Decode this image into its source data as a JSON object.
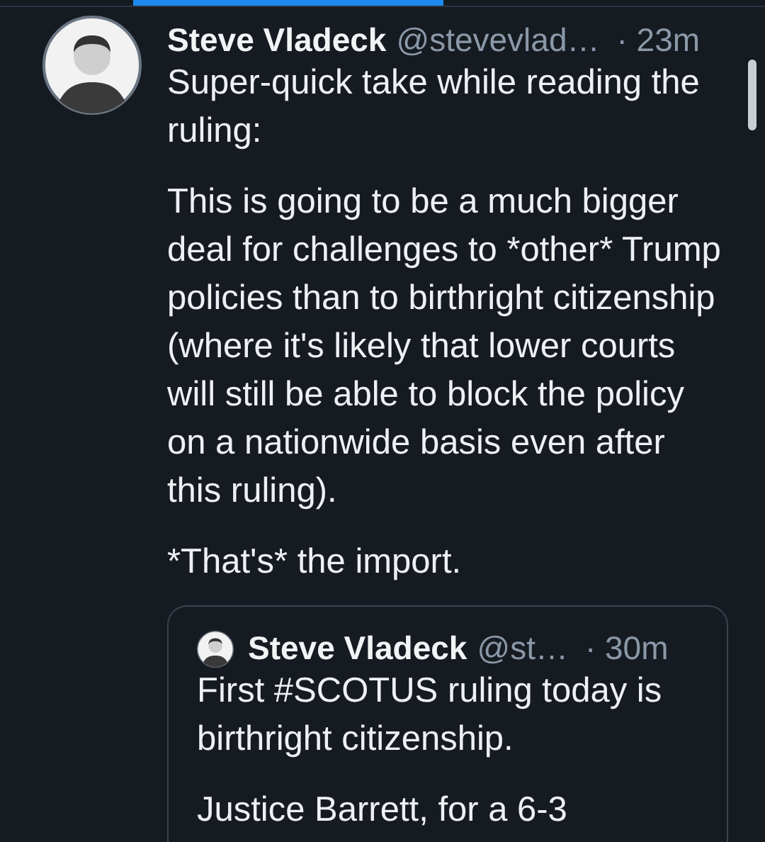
{
  "tabs": [
    {
      "selected": true
    }
  ],
  "post": {
    "author": "Steve Vladeck",
    "handle": "@stevevlad…",
    "time": "· 23m",
    "paragraphs": [
      "Super-quick take while reading the ruling:",
      "This is going to be a much bigger deal for challenges to *other* Trump policies than to birthright citizenship (where it's likely that lower courts will still be able to block the policy on a nationwide basis even after this ruling).",
      "*That's* the import."
    ],
    "quote": {
      "author": "Steve Vladeck",
      "handle": "@st…",
      "time": "· 30m",
      "paragraphs": [
        "First #SCOTUS ruling today is birthright citizenship.",
        "Justice Barrett, for a 6-3"
      ]
    }
  }
}
